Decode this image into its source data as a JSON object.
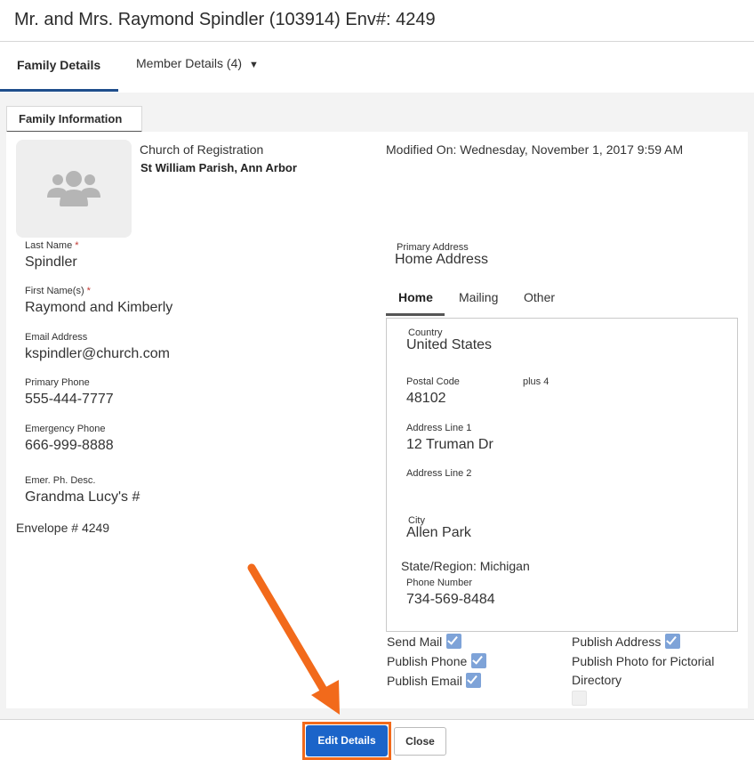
{
  "window": {
    "title": "Mr. and Mrs. Raymond Spindler (103914) Env#: 4249"
  },
  "tabs": {
    "family_details": "Family Details",
    "member_details": "Member Details (4)",
    "member_caret": "▼"
  },
  "section": {
    "title": "Family Information"
  },
  "avatar": {
    "icon": "people-group-icon"
  },
  "church": {
    "label": "Church of Registration",
    "value": "St William Parish, Ann Arbor"
  },
  "modified": "Modified On: Wednesday, November 1, 2017 9:59 AM",
  "fields": {
    "last_name": {
      "label": "Last Name",
      "required": "*",
      "value": "Spindler"
    },
    "first_names": {
      "label": "First Name(s)",
      "required": "*",
      "value": "Raymond and Kimberly"
    },
    "email": {
      "label": "Email Address",
      "value": "kspindler@church.com"
    },
    "primary_phone": {
      "label": "Primary Phone",
      "value": "555-444-7777"
    },
    "emergency_phone": {
      "label": "Emergency Phone",
      "value": "666-999-8888"
    },
    "emer_desc": {
      "label": "Emer. Ph. Desc.",
      "value": "Grandma Lucy's #"
    }
  },
  "envelope": "Envelope # 4249",
  "primary_address": {
    "label": "Primary Address",
    "value": "Home Address"
  },
  "address_tabs": [
    "Home",
    "Mailing",
    "Other"
  ],
  "address": {
    "country": {
      "label": "Country",
      "value": "United States"
    },
    "postal_code": {
      "label": "Postal Code",
      "value": "48102"
    },
    "plus4": {
      "label": "plus 4",
      "value": ""
    },
    "line1": {
      "label": "Address Line 1",
      "value": "12 Truman Dr"
    },
    "line2": {
      "label": "Address Line 2",
      "value": ""
    },
    "city": {
      "label": "City",
      "value": "Allen Park"
    },
    "state": "State/Region: Michigan",
    "phone": {
      "label": "Phone Number",
      "value": "734-569-8484"
    }
  },
  "options": {
    "send_mail": {
      "label": "Send Mail",
      "checked": true
    },
    "publish_phone": {
      "label": "Publish Phone",
      "checked": true
    },
    "publish_email": {
      "label": "Publish Email",
      "checked": true
    },
    "publish_address": {
      "label": "Publish Address",
      "checked": true
    },
    "publish_photo": {
      "label_line1": "Publish Photo for Pictorial",
      "label_line2": "Directory",
      "checked": false
    }
  },
  "footer": {
    "edit_label": "Edit Details",
    "close_label": "Close"
  },
  "colors": {
    "primary_button": "#1b64c9",
    "highlight_annotation": "#f26a1b",
    "checkbox_checked": "#7ea3d8",
    "active_tab_underline": "#1f4e8c"
  }
}
